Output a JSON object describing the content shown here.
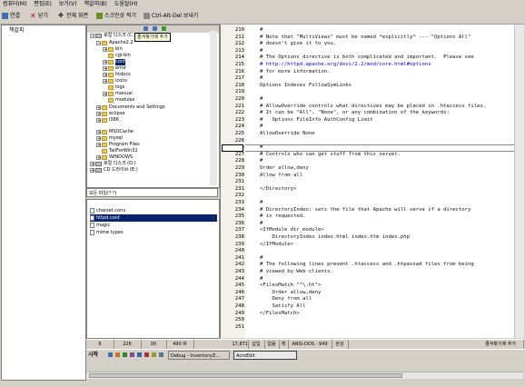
{
  "menu": [
    "컴퓨터(M)",
    "편집(E)",
    "보기(V)",
    "책갈피(B)",
    "도움말(H)"
  ],
  "toolbar": {
    "connect": "연결",
    "close": "닫기",
    "fullscreen": "전체 화면",
    "screenshot": "스크린샷 찍기",
    "ctrl_alt_del": "Ctrl-Alt-Del 보내기"
  },
  "favorites": {
    "title": "책갈피"
  },
  "tooltip": "즐겨찾기에 추가",
  "tree": [
    {
      "label": "로컬 디스크 (C:)",
      "exp": "−",
      "kind": "drive"
    },
    {
      "label": "Apache2.2",
      "exp": "−",
      "kind": "folder"
    },
    {
      "label": "bin",
      "exp": "+",
      "kind": "folder"
    },
    {
      "label": "cgi-bin",
      "exp": "",
      "kind": "folder"
    },
    {
      "label": "conf",
      "exp": "+",
      "kind": "folder",
      "selected": true
    },
    {
      "label": "error",
      "exp": "+",
      "kind": "folder"
    },
    {
      "label": "htdocs",
      "exp": "+",
      "kind": "folder"
    },
    {
      "label": "icons",
      "exp": "+",
      "kind": "folder"
    },
    {
      "label": "logs",
      "exp": "",
      "kind": "folder"
    },
    {
      "label": "manual",
      "exp": "+",
      "kind": "folder"
    },
    {
      "label": "modules",
      "exp": "",
      "kind": "folder"
    },
    {
      "label": "Documents and Settings",
      "exp": "+",
      "kind": "folder"
    },
    {
      "label": "eclipse",
      "exp": "+",
      "kind": "folder"
    },
    {
      "label": "i386",
      "exp": "+",
      "kind": "folder"
    },
    {
      "label": "MSOCache",
      "exp": "+",
      "kind": "folder"
    },
    {
      "label": "mysql",
      "exp": "+",
      "kind": "folder"
    },
    {
      "label": "Program Files",
      "exp": "+",
      "kind": "folder"
    },
    {
      "label": "TailForWin32",
      "exp": "",
      "kind": "folder"
    },
    {
      "label": "WINDOWS",
      "exp": "+",
      "kind": "folder"
    },
    {
      "label": "로컬 디스크 (D:)",
      "exp": "+",
      "kind": "drive"
    },
    {
      "label": "CD 드라이브 (E:)",
      "exp": "+",
      "kind": "drive"
    }
  ],
  "filter": "모든 파일(*.*)",
  "files": [
    {
      "name": "charset.conv"
    },
    {
      "name": "httpd.conf",
      "selected": true
    },
    {
      "name": "magic"
    },
    {
      "name": "mime.types"
    }
  ],
  "editor": {
    "current_line": 226,
    "lines": [
      {
        "n": "210",
        "t": "#"
      },
      {
        "n": "211",
        "t": "# Note that \"MultiViews\" must be named *explicitly* --- \"Options All\""
      },
      {
        "n": "212",
        "t": "# doesn't give it to you."
      },
      {
        "n": "213",
        "t": "#"
      },
      {
        "n": "214",
        "t": "# The Options directive is both complicated and important.  Please see"
      },
      {
        "n": "215",
        "t": "# http://httpd.apache.org/docs/2.2/mod/core.html#options"
      },
      {
        "n": "216",
        "t": "# for more information."
      },
      {
        "n": "217",
        "t": "#"
      },
      {
        "n": "218",
        "t": "Options Indexes FollowSymLinks"
      },
      {
        "n": "219",
        "t": ""
      },
      {
        "n": "220",
        "t": "#"
      },
      {
        "n": "221",
        "t": "# AllowOverride controls what directives may be placed in .htaccess files."
      },
      {
        "n": "222",
        "t": "# It can be \"All\", \"None\", or any combination of the keywords:"
      },
      {
        "n": "223",
        "t": "#   Options FileInfo AuthConfig Limit"
      },
      {
        "n": "224",
        "t": "#"
      },
      {
        "n": "225",
        "t": "AllowOverride None"
      },
      {
        "n": "226",
        "t": ""
      },
      {
        "n": "226",
        "t": "#"
      },
      {
        "n": "227",
        "t": "# Controls who can get stuff from this server."
      },
      {
        "n": "228",
        "t": "#"
      },
      {
        "n": "229",
        "t": "Order allow,deny"
      },
      {
        "n": "230",
        "t": "Allow from all"
      },
      {
        "n": "231",
        "t": ""
      },
      {
        "n": "231",
        "t": "</Directory>"
      },
      {
        "n": "232",
        "t": ""
      },
      {
        "n": "233",
        "t": "#"
      },
      {
        "n": "234",
        "t": "# DirectoryIndex: sets the file that Apache will serve if a directory"
      },
      {
        "n": "235",
        "t": "# is requested."
      },
      {
        "n": "236",
        "t": "#"
      },
      {
        "n": "237",
        "t": "<IfModule dir_module>"
      },
      {
        "n": "238",
        "t": "    DirectoryIndex index.html index.htm index.php"
      },
      {
        "n": "239",
        "t": "</IfModule>"
      },
      {
        "n": "240",
        "t": ""
      },
      {
        "n": "241",
        "t": "#"
      },
      {
        "n": "242",
        "t": "# The following lines prevent .htaccess and .htpasswd files from being"
      },
      {
        "n": "243",
        "t": "# viewed by Web clients."
      },
      {
        "n": "244",
        "t": "#"
      },
      {
        "n": "245",
        "t": "<FilesMatch \"^\\.ht\">"
      },
      {
        "n": "246",
        "t": "    Order allow,deny"
      },
      {
        "n": "247",
        "t": "    Deny from all"
      },
      {
        "n": "248",
        "t": "    Satisfy All"
      },
      {
        "n": "249",
        "t": "</FilesMatch>"
      },
      {
        "n": "250",
        "t": ""
      },
      {
        "n": "251",
        "t": ""
      }
    ]
  },
  "status": {
    "col": "6",
    "line": "226",
    "a": "00",
    "size": "490 바",
    "total": "17,871",
    "mode": "삽입",
    "lock": "없음",
    "eol": "핵",
    "encoding": "ANSI-DOS - 949",
    "state": "완성",
    "hint": "즐겨찾기에 추가"
  },
  "taskbar": {
    "start": "시작",
    "tasks": [
      "Debug - Inventory.E...",
      "AcroEdit"
    ]
  },
  "colors": {
    "selection": "#0a246a",
    "chrome": "#d4d0c8",
    "url": "#0000ee"
  }
}
